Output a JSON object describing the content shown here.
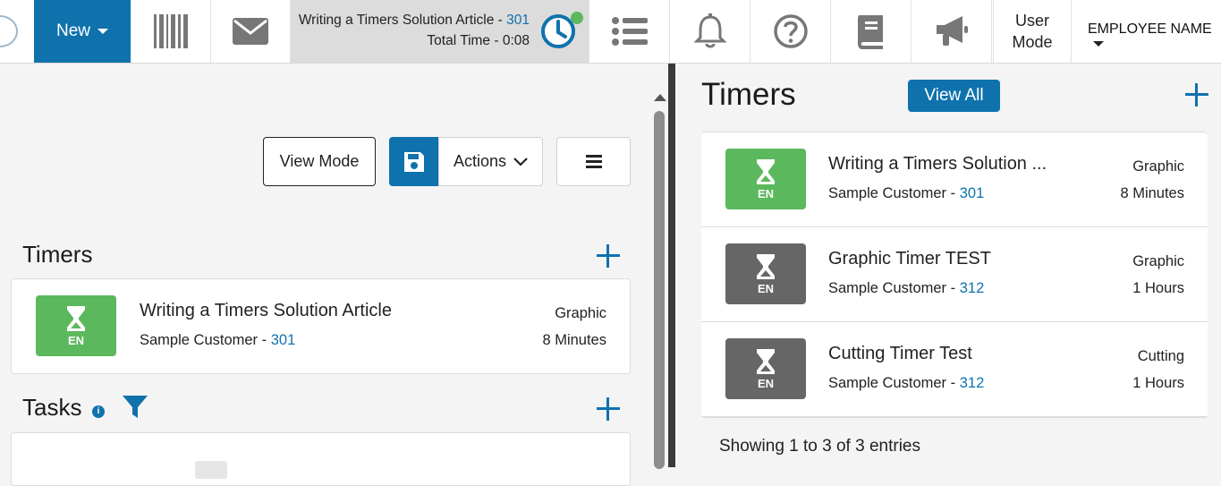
{
  "topbar": {
    "new_label": "New",
    "timer": {
      "title": "Writing a Timers Solution Article",
      "sep": " - ",
      "number": "301",
      "total_time": "Total Time - 0:08"
    },
    "user_mode": "User Mode",
    "user_mode_line1": "User",
    "user_mode_line2": "Mode",
    "employee_name": "EMPLOYEE NAME",
    "icons": [
      "barcode-icon",
      "mail-icon",
      "clock-icon",
      "list-icon",
      "bell-icon",
      "help-icon",
      "book-icon",
      "megaphone-icon"
    ]
  },
  "left": {
    "toolbar": {
      "view_mode": "View Mode",
      "actions": "Actions"
    },
    "timers_title": "Timers",
    "timer_card": {
      "badge": "EN",
      "title": "Writing a Timers Solution Article",
      "customer": "Sample Customer",
      "sep": " - ",
      "number": "301",
      "type": "Graphic",
      "duration": "8 Minutes"
    },
    "tasks_title": "Tasks",
    "info_icon": "i"
  },
  "right": {
    "title": "Timers",
    "view_all": "View All",
    "rows": [
      {
        "badge": "EN",
        "title": "Writing a Timers Solution ...",
        "customer": "Sample Customer",
        "sep": " - ",
        "number": "301",
        "type": "Graphic",
        "duration": "8 Minutes",
        "color": "#5cb85c"
      },
      {
        "badge": "EN",
        "title": "Graphic Timer TEST",
        "customer": "Sample Customer",
        "sep": " - ",
        "number": "312",
        "type": "Graphic",
        "duration": "1 Hours",
        "color": "#666666"
      },
      {
        "badge": "EN",
        "title": "Cutting Timer Test",
        "customer": "Sample Customer",
        "sep": " - ",
        "number": "312",
        "type": "Cutting",
        "duration": "1 Hours",
        "color": "#666666"
      }
    ],
    "showing": "Showing 1 to 3 of 3 entries"
  },
  "colors": {
    "accent": "#0f72ad",
    "success": "#5cb85c",
    "neutral": "#666666"
  }
}
